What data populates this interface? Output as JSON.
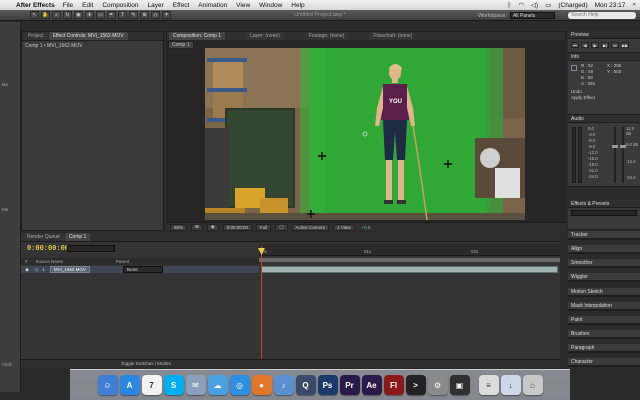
{
  "menubar": {
    "app_name": "After Effects",
    "items": [
      "File",
      "Edit",
      "Composition",
      "Layer",
      "Effect",
      "Animation",
      "View",
      "Window",
      "Help"
    ],
    "battery": "(Charged)",
    "clock": "Mon 23:17"
  },
  "appbar": {
    "document_title": "Untitled Project.aep *",
    "workspace_label": "Workspace:",
    "workspace_value": "All Panels",
    "search_placeholder": "Search Help"
  },
  "project_panel": {
    "tabs": [
      "Project",
      "Effect Controls: MVI_1562.MOV"
    ],
    "breadcrumb": "Comp 1 • MVI_1562.MOV"
  },
  "left_strip": {
    "labels": [
      "Na",
      "Me",
      "Click"
    ]
  },
  "viewer": {
    "tabs": [
      "Composition: Comp 1",
      "Layer: (none)",
      "Footage: (none)",
      "Flowchart: (none)"
    ],
    "comp_label": "Comp 1",
    "zoom": "50%",
    "time": "0:00:00:00",
    "resolution": "Full",
    "camera": "Active Camera",
    "views": "1 View",
    "exposure": "+0.0"
  },
  "timeline": {
    "tabs": [
      "Render Queue",
      "Comp 1"
    ],
    "timecode": "0:00:00:00",
    "headers": [
      "#",
      "Source Name",
      "Parent"
    ],
    "layer": {
      "index": "1",
      "name": "MVI_1562.MOV",
      "parent": "None"
    },
    "ruler_ticks": [
      "0s",
      "01s",
      "02s"
    ],
    "toggle_label": "Toggle Switches / Modes"
  },
  "right_panels": {
    "preview": "Preview",
    "info": "Info",
    "info_values": {
      "R": "R : 52",
      "G": "G : 50",
      "B": "B : 58",
      "A": "A : 255",
      "X": "X : 296",
      "Y": "Y : 502"
    },
    "info_note_1": "Undo",
    "info_note_2": "Apply Effect",
    "audio": "Audio",
    "audio_db": [
      "0.0",
      "-3.0",
      "-6.0",
      "-9.0",
      "-12.0",
      "-15.0",
      "-18.0",
      "-21.0",
      "-24.0"
    ],
    "audio_db_right": [
      "12.0 dB",
      "0.0 dB",
      "-12.0",
      "-24.0"
    ],
    "effects_presets": "Effects & Presets",
    "collapsed": [
      "Tracker",
      "Align",
      "Smoother",
      "Wiggler",
      "Motion Sketch",
      "Mask Interpolation",
      "Paint",
      "Brushes",
      "Paragraph",
      "Character"
    ]
  },
  "dock": {
    "icons": [
      {
        "name": "finder-icon",
        "color": "#3f7fd6",
        "glyph": "☺"
      },
      {
        "name": "app-store-icon",
        "color": "#2a86e0",
        "glyph": "A"
      },
      {
        "name": "calendar-icon",
        "color": "#f2f2f2",
        "glyph": "7"
      },
      {
        "name": "skype-icon",
        "color": "#00aff0",
        "glyph": "S"
      },
      {
        "name": "mail-icon",
        "color": "#8aa0b8",
        "glyph": "✉"
      },
      {
        "name": "ichat-icon",
        "color": "#4aa0e0",
        "glyph": "☁"
      },
      {
        "name": "safari-icon",
        "color": "#2d8fe0",
        "glyph": "◎"
      },
      {
        "name": "firefox-icon",
        "color": "#e0762a",
        "glyph": "●"
      },
      {
        "name": "itunes-icon",
        "color": "#5a8fd0",
        "glyph": "♪"
      },
      {
        "name": "quicktime-icon",
        "color": "#3a4a6a",
        "glyph": "Q"
      },
      {
        "name": "photoshop-icon",
        "color": "#1b3a6b",
        "glyph": "Ps"
      },
      {
        "name": "premiere-icon",
        "color": "#2a1a4a",
        "glyph": "Pr"
      },
      {
        "name": "after-effects-icon",
        "color": "#2a1a4a",
        "glyph": "Ae"
      },
      {
        "name": "flash-icon",
        "color": "#8a1a1a",
        "glyph": "Fl"
      },
      {
        "name": "terminal-icon",
        "color": "#222222",
        "glyph": ">"
      },
      {
        "name": "system-preferences-icon",
        "color": "#8a8a8a",
        "glyph": "⚙"
      },
      {
        "name": "photo-booth-icon",
        "color": "#303030",
        "glyph": "▣"
      },
      {
        "name": "documents-stack-icon",
        "color": "#dcdcdc",
        "glyph": "≡"
      },
      {
        "name": "downloads-stack-icon",
        "color": "#cfd8e8",
        "glyph": "↓"
      },
      {
        "name": "trash-icon",
        "color": "#c8c8c8",
        "glyph": "⌂"
      }
    ]
  }
}
